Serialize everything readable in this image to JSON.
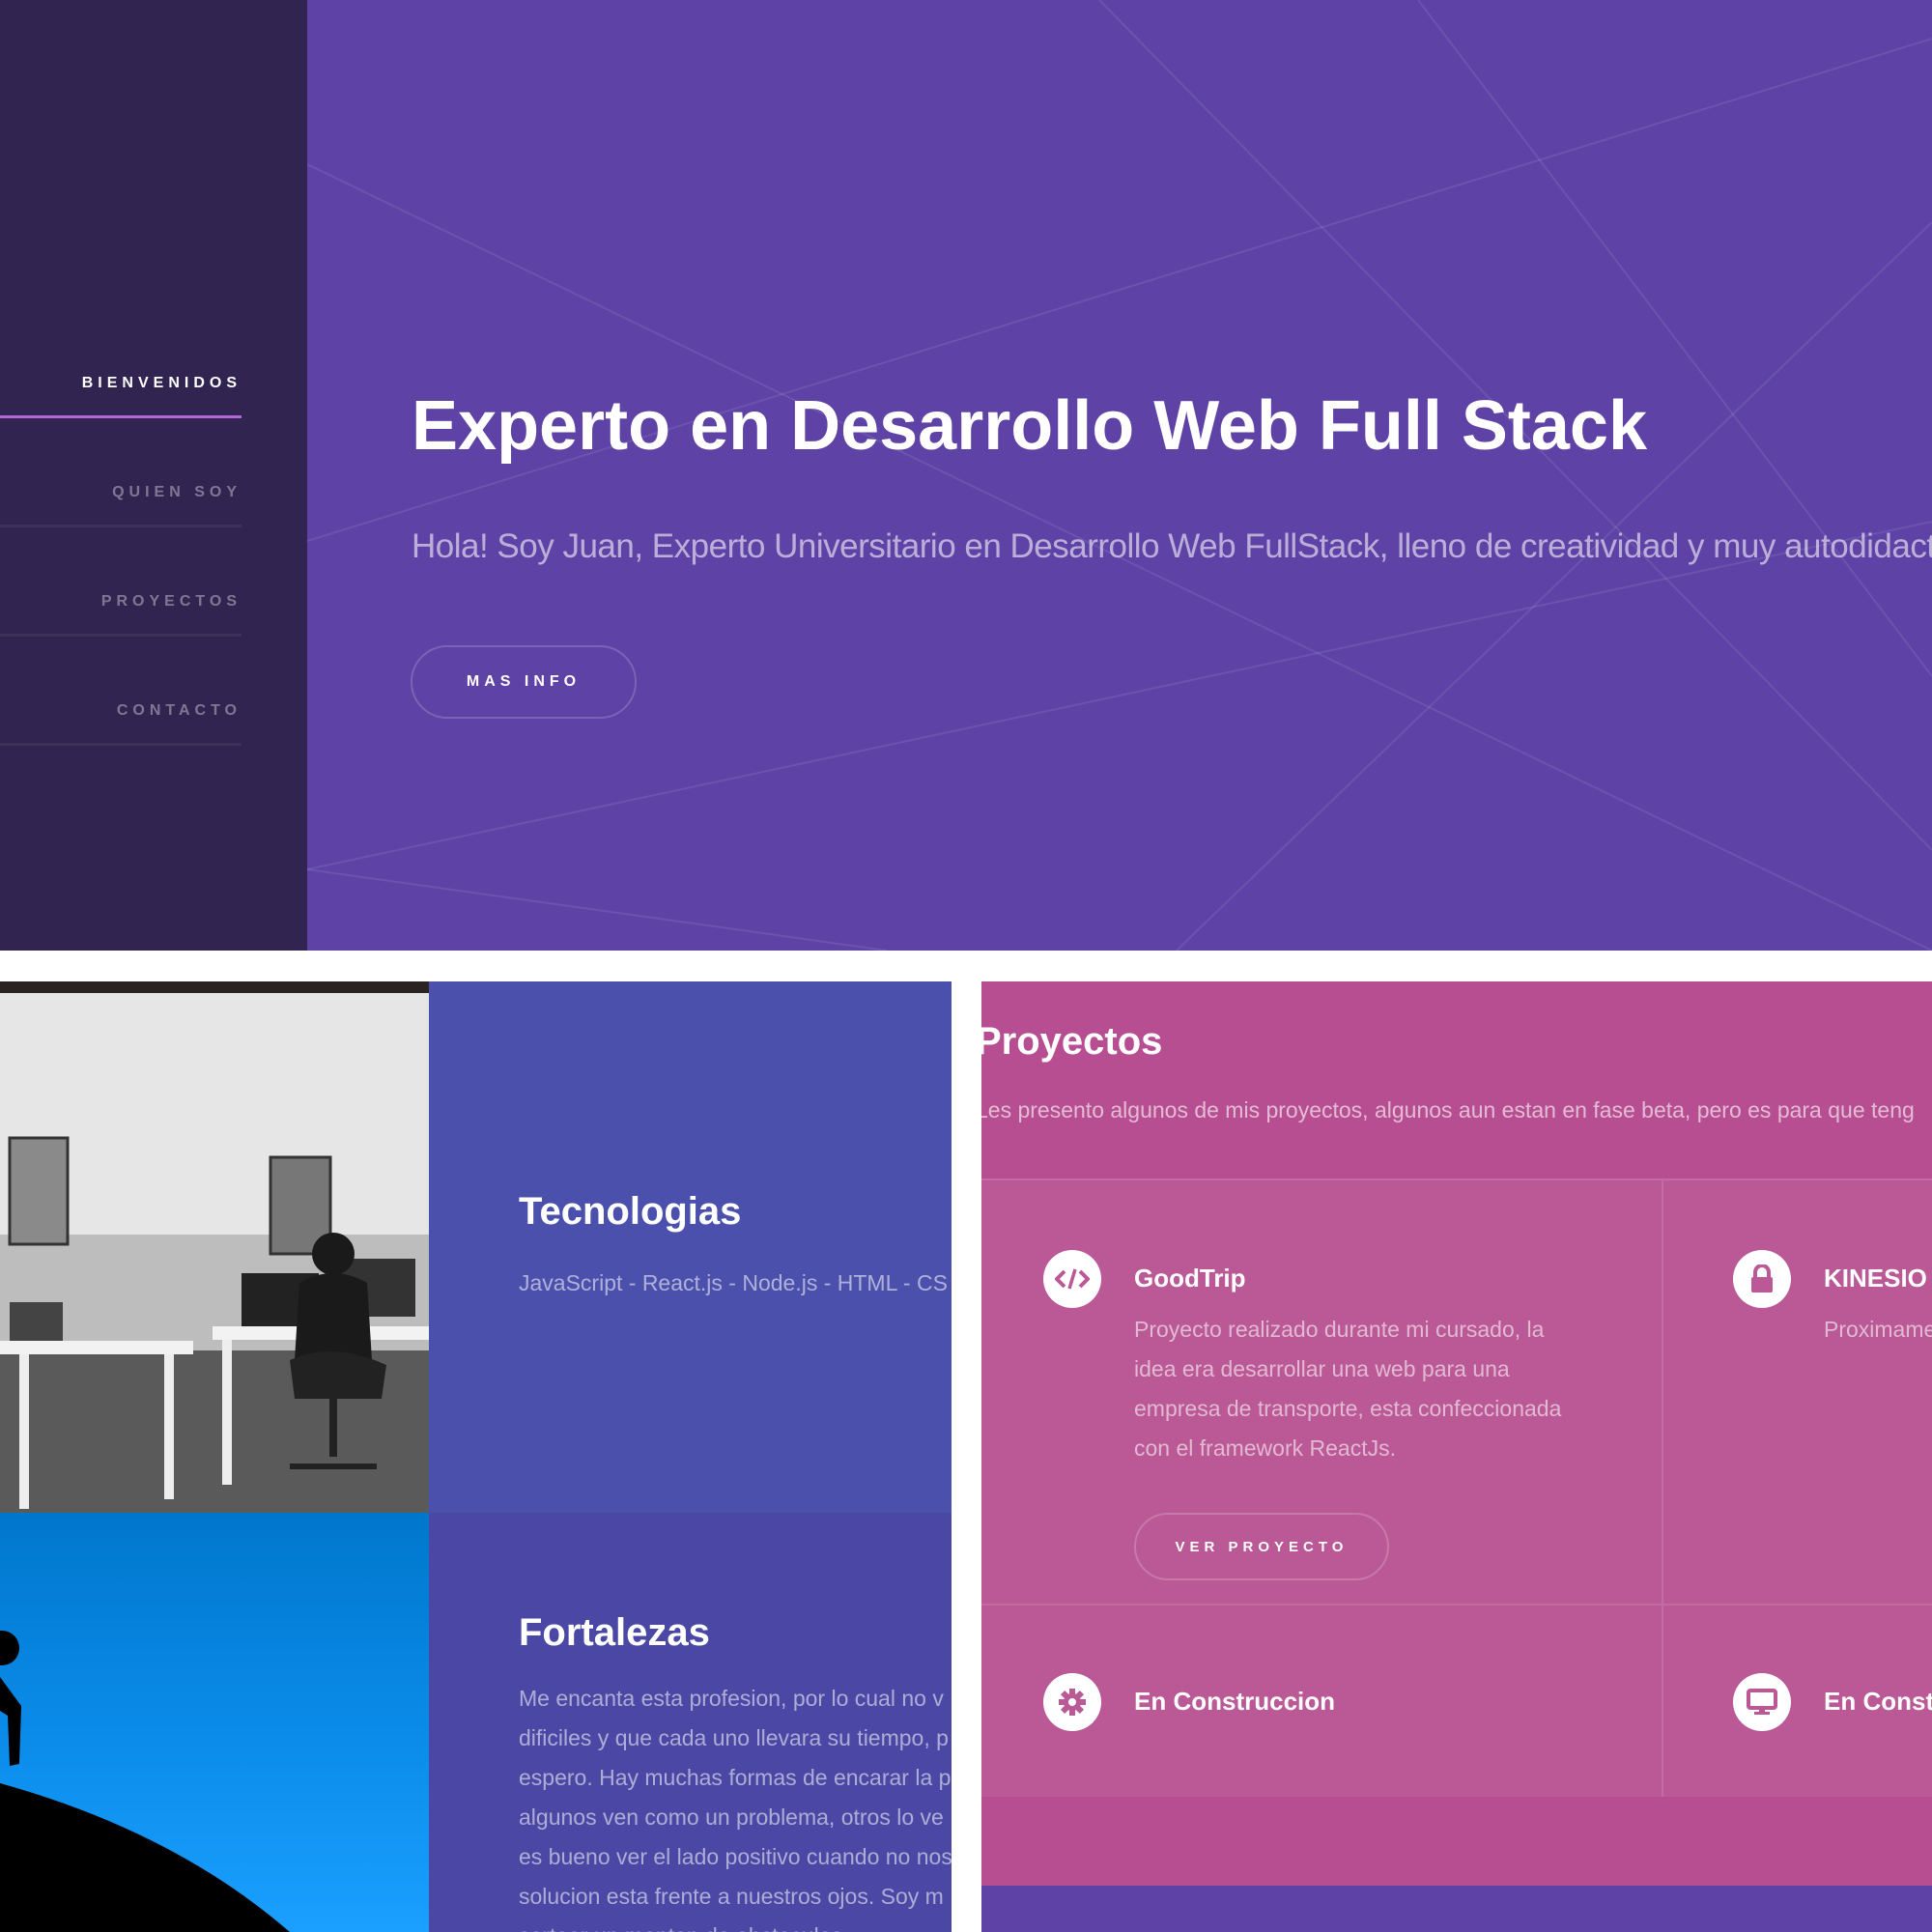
{
  "sidebar": {
    "items": [
      {
        "label": "BIENVENIDOS",
        "active": true
      },
      {
        "label": "QUIEN SOY",
        "active": false
      },
      {
        "label": "PROYECTOS",
        "active": false
      },
      {
        "label": "CONTACTO",
        "active": false
      }
    ]
  },
  "hero": {
    "title": "Experto en Desarrollo Web Full Stack",
    "text": "Hola! Soy Juan, Experto Universitario en Desarrollo Web FullStack, lleno de creatividad y muy autodidact",
    "button_label": "MAS INFO"
  },
  "about": {
    "tech_title": "Tecnologias",
    "tech_text": "JavaScript - React.js - Node.js - HTML - CS",
    "strength_title": "Fortalezas",
    "strength_lines": [
      "Me encanta esta profesion, por lo cual no v",
      "dificiles y que cada uno llevara su tiempo, p",
      "espero. Hay muchas formas de encarar la p",
      "algunos ven como un problema, otros lo ve",
      "es bueno ver el lado positivo cuando no nos",
      "solucion esta frente a nuestros ojos. Soy m",
      "sortear un monton de obstaculos."
    ]
  },
  "projects": {
    "title": "Proyectos",
    "intro": "Les presento algunos de mis proyectos, algunos aun estan en fase beta, pero es para que teng",
    "items": [
      {
        "icon": "code-icon",
        "title": "GoodTrip",
        "lines": [
          "Proyecto realizado durante mi cursado, la",
          "idea era desarrollar una web para una",
          "empresa de transporte, esta confeccionada",
          "con el framework ReactJs."
        ],
        "button_label": "VER PROYECTO"
      },
      {
        "icon": "lock-icon",
        "title": "KINESIO",
        "lines": [
          "Proximame"
        ]
      },
      {
        "icon": "gear-icon",
        "title": "En Construccion"
      },
      {
        "icon": "monitor-icon",
        "title": "En Const"
      }
    ]
  },
  "colors": {
    "sidebar_bg": "#312450",
    "hero_bg": "#5e42a6",
    "about_bg": "#4c50ad",
    "projects_bg": "#b74e91",
    "accent": "#b566d9"
  }
}
